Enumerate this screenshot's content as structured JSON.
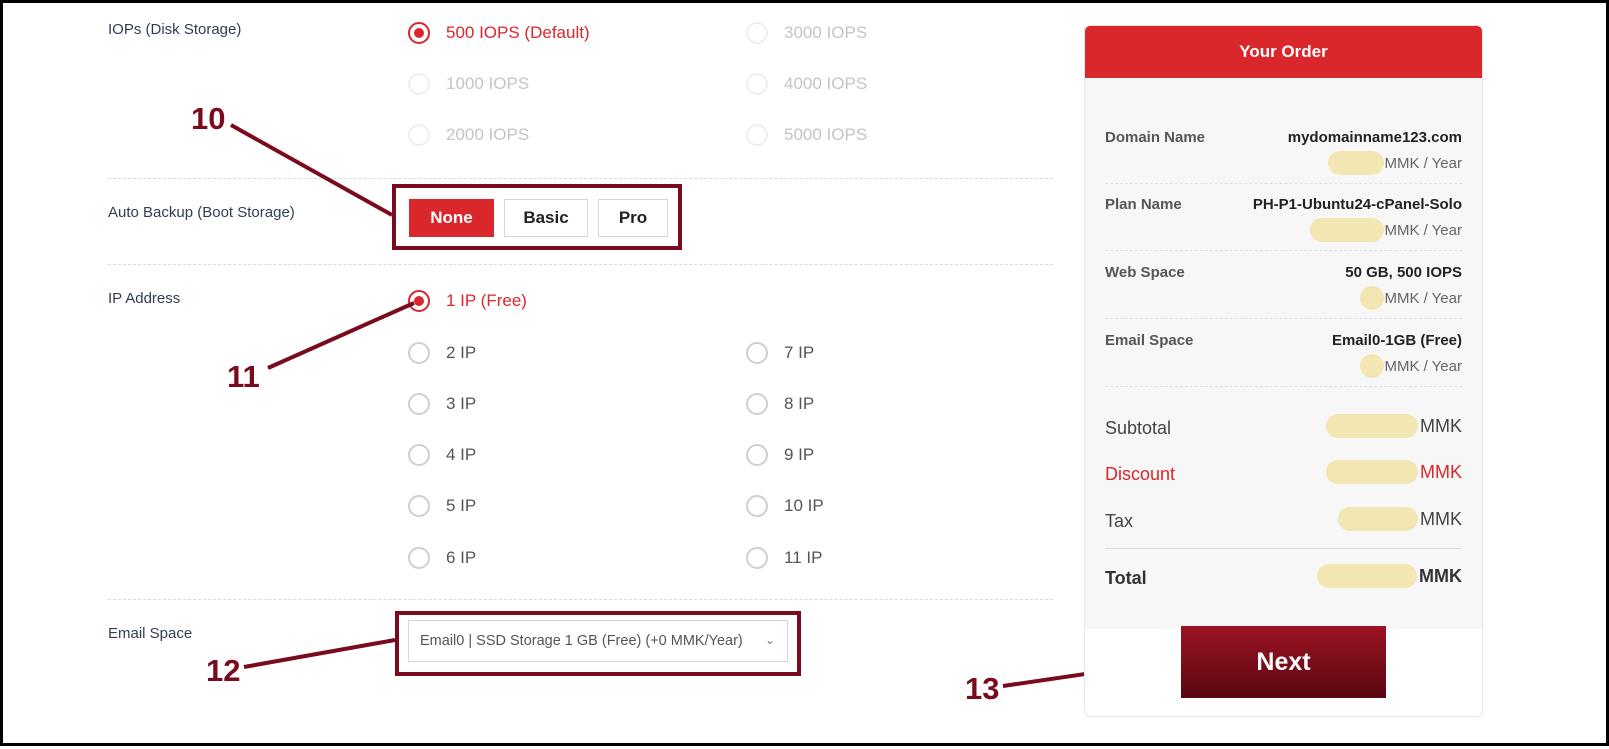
{
  "iops": {
    "label": "IOPs (Disk Storage)",
    "options": [
      "500 IOPS (Default)",
      "3000 IOPS",
      "1000 IOPS",
      "4000 IOPS",
      "2000 IOPS",
      "5000 IOPS"
    ]
  },
  "auto_backup": {
    "label": "Auto Backup (Boot Storage)",
    "options": [
      "None",
      "Basic",
      "Pro"
    ],
    "selected": "None"
  },
  "ip_address": {
    "label": "IP Address",
    "options": [
      "1 IP (Free)",
      "2 IP",
      "3 IP",
      "4 IP",
      "5 IP",
      "6 IP",
      "7 IP",
      "8 IP",
      "9 IP",
      "10 IP",
      "11 IP"
    ]
  },
  "email_space": {
    "label": "Email Space",
    "selected_value": "Email0 | SSD Storage 1 GB (Free) (+0 MMK/Year)"
  },
  "callouts": [
    "10",
    "11",
    "12",
    "13"
  ],
  "order": {
    "title": "Your Order",
    "rows": [
      {
        "label": "Domain Name",
        "value": "mydomainname123.com",
        "sub": "MMK / Year"
      },
      {
        "label": "Plan Name",
        "value": "PH-P1-Ubuntu24-cPanel-Solo",
        "sub": "MMK / Year"
      },
      {
        "label": "Web Space",
        "value": "50 GB, 500 IOPS",
        "sub": "MMK / Year"
      },
      {
        "label": "Email Space",
        "value": "Email0-1GB (Free)",
        "sub": "MMK / Year"
      }
    ],
    "subtotal_label": "Subtotal",
    "discount_label": "Discount",
    "tax_label": "Tax",
    "total_label": "Total",
    "currency": "MMK"
  },
  "next_label": "Next",
  "colors": {
    "accent": "#d9272b",
    "callout": "#7a0a1e",
    "redacted": "#f2e6b3"
  }
}
